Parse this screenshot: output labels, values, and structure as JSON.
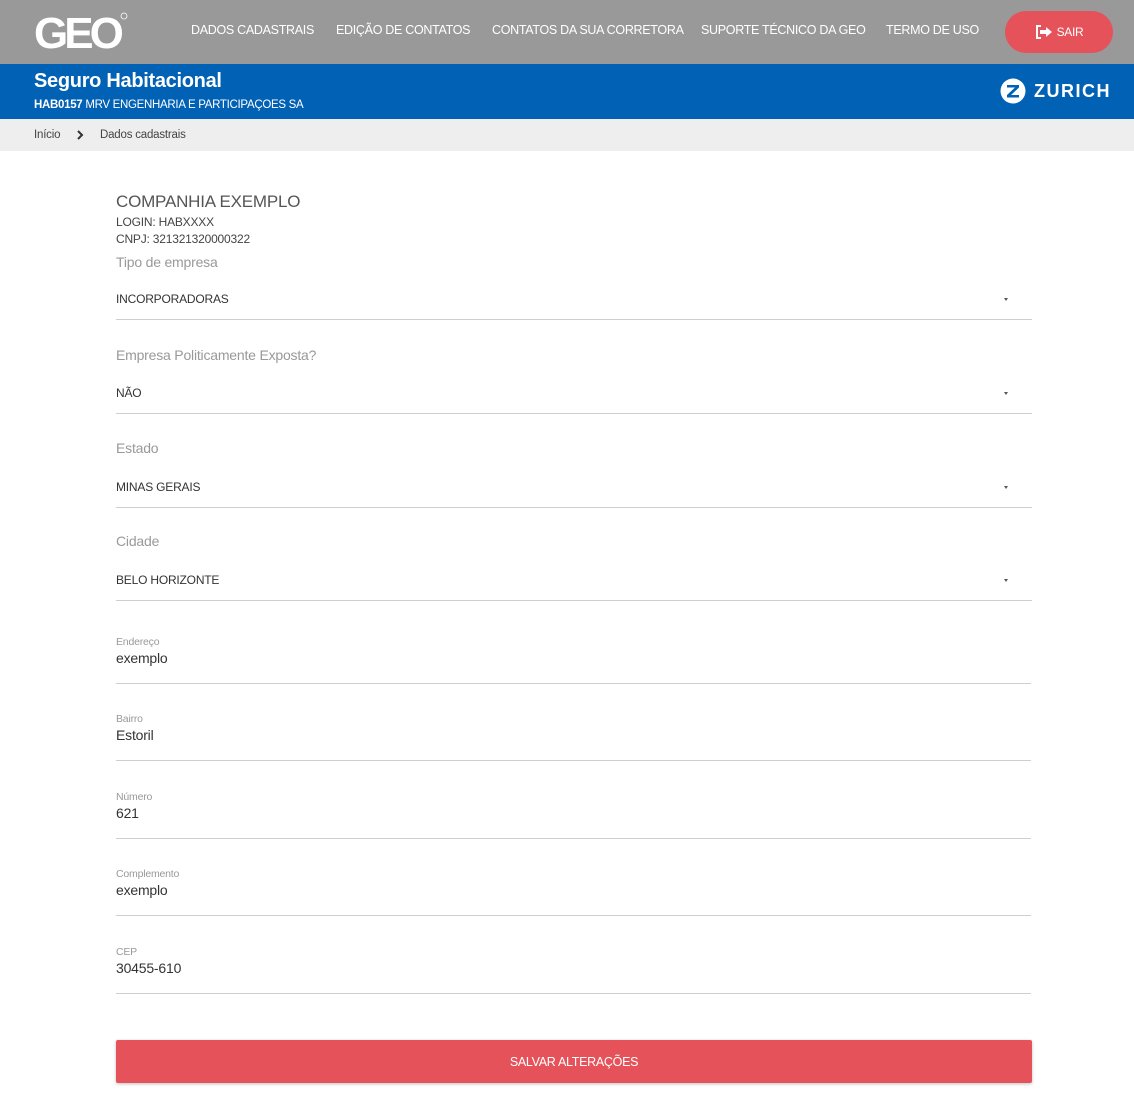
{
  "header": {
    "logo_text": "GEO",
    "nav": [
      {
        "label": "DADOS CADASTRAIS"
      },
      {
        "label": "EDIÇÃO DE CONTATOS"
      },
      {
        "label": "CONTATOS DA SUA CORRETORA"
      },
      {
        "label": "SUPORTE TÉCNICO DA GEO"
      },
      {
        "label": "TERMO DE USO"
      }
    ],
    "logout_label": "SAIR",
    "logout_icon": "sign-out-icon",
    "accent_color": "#e5525a",
    "bar_color": "#999999"
  },
  "banner": {
    "title": "Seguro Habitacional",
    "code": "HAB0157",
    "company": "MRV ENGENHARIA E PARTICIPAÇOES SA",
    "brand": "ZURICH",
    "brand_icon": "zurich-z-logo",
    "color": "#0161b5"
  },
  "breadcrumb": {
    "items": [
      "Início",
      "Dados cadastrais"
    ],
    "separator_icon": "chevron-right-icon"
  },
  "company": {
    "name": "COMPANHIA EXEMPLO",
    "login": "LOGIN: HABXXXX",
    "cnpj": "CNPJ: 321321320000322"
  },
  "selects": {
    "tipo": {
      "label": "Tipo de empresa",
      "value": "INCORPORADORAS"
    },
    "pep": {
      "label": "Empresa Politicamente Exposta?",
      "value": "NÃO"
    },
    "estado": {
      "label": "Estado",
      "value": "MINAS GERAIS"
    },
    "cidade": {
      "label": "Cidade",
      "value": "BELO HORIZONTE"
    }
  },
  "fields": {
    "endereco": {
      "label": "Endereço",
      "value": "exemplo"
    },
    "bairro": {
      "label": "Bairro",
      "value": "Estoril"
    },
    "numero": {
      "label": "Número",
      "value": "621"
    },
    "complemento": {
      "label": "Complemento",
      "value": "exemplo"
    },
    "cep": {
      "label": "CEP",
      "value": "30455-610"
    }
  },
  "save_label": "SALVAR ALTERAÇÕES"
}
